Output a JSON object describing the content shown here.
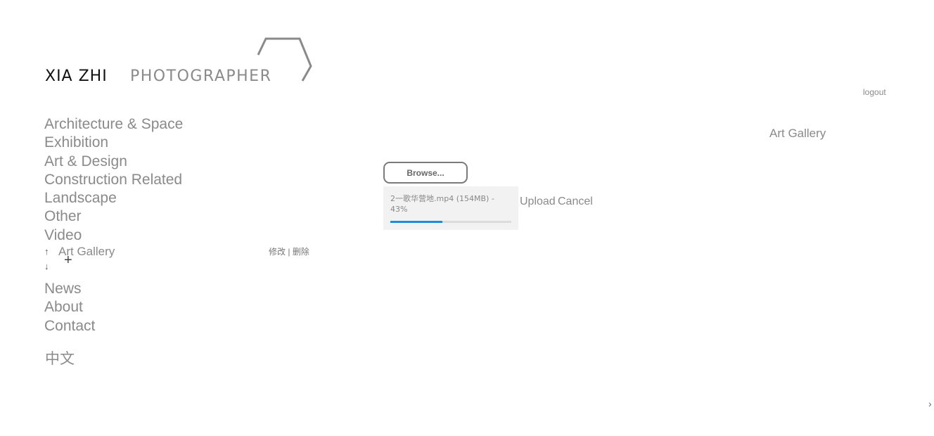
{
  "logo": {
    "name": "XIA ZHI",
    "title": "PHOTOGRAPHER"
  },
  "header": {
    "logout": "logout"
  },
  "content": {
    "category_label": "Art Gallery"
  },
  "nav": {
    "items": [
      "Architecture & Space",
      "Exhibition",
      "Art & Design",
      "Construction Related",
      "Landscape",
      "Other",
      "Video"
    ],
    "sub_item": {
      "label": "Art Gallery",
      "up_icon": "↑",
      "down_icon": "↓",
      "add_icon": "+",
      "edit": "修改",
      "separator": "|",
      "delete": "删除"
    },
    "lower_items": [
      "News",
      "About",
      "Contact"
    ],
    "language": "中文"
  },
  "upload": {
    "browse_label": "Browse...",
    "file_name": "2一歌华营地.mp4",
    "file_size": "(154MB)",
    "progress_text": "43%",
    "progress": 0.43,
    "upload_label": "Upload",
    "cancel_label": "Cancel",
    "progress_color": "#1a8fd6"
  },
  "pager": {
    "next_icon": "›"
  }
}
